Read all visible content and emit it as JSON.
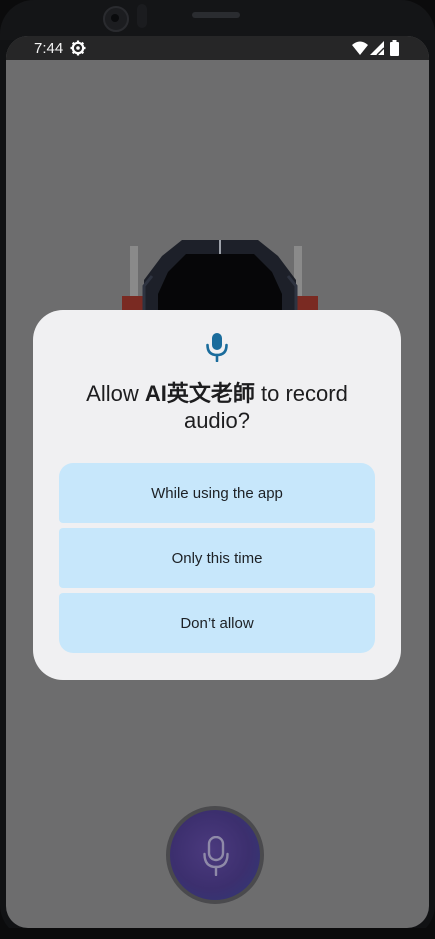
{
  "status_bar": {
    "time": "7:44",
    "icons": [
      "gear-icon",
      "wifi-icon",
      "signal-icon",
      "battery-icon"
    ]
  },
  "dialog": {
    "icon": "mic-icon",
    "title_prefix": "Allow ",
    "app_name": "AI英文老師",
    "title_suffix": " to record audio?",
    "options": [
      {
        "label": "While using the app"
      },
      {
        "label": "Only this time"
      },
      {
        "label": "Don’t allow"
      }
    ]
  },
  "record_button": {
    "icon": "mic-icon"
  },
  "colors": {
    "dialog_bg": "#f0f0f2",
    "option_bg": "#c7e7fb",
    "accent": "#1a6c9c",
    "scrim": "#6d6d6e"
  }
}
